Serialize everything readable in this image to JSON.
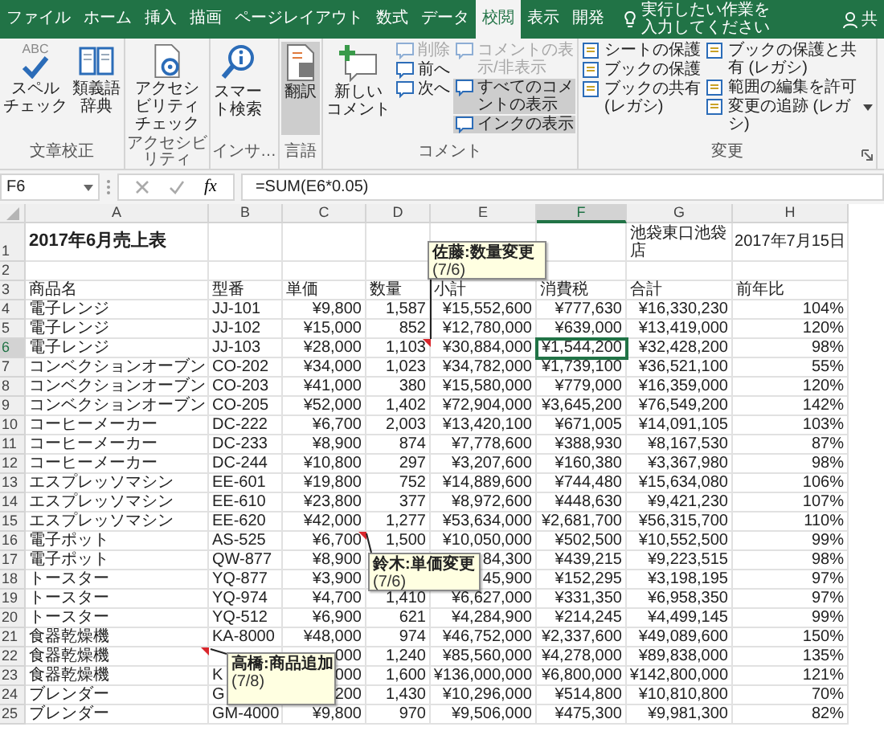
{
  "tabs": [
    {
      "label": "ファイル",
      "selected": false
    },
    {
      "label": "ホーム",
      "selected": false
    },
    {
      "label": "挿入",
      "selected": false
    },
    {
      "label": "描画",
      "selected": false
    },
    {
      "label": "ページレイアウト",
      "selected": false
    },
    {
      "label": "数式",
      "selected": false
    },
    {
      "label": "データ",
      "selected": false
    },
    {
      "label": "校閲",
      "selected": true
    },
    {
      "label": "表示",
      "selected": false
    },
    {
      "label": "開発",
      "selected": false
    }
  ],
  "tell_me": "実行したい作業を入力してください",
  "share": "共",
  "ribbon": [
    {
      "label": "文章校正",
      "items": [
        {
          "kind": "large",
          "icon_text": "ABC",
          "lines": [
            "スペル",
            "チェック"
          ],
          "on": false
        },
        {
          "kind": "large",
          "lines": [
            "類義語",
            "辞典"
          ],
          "on": false
        }
      ]
    },
    {
      "label": "アクセシビリティ",
      "items": [
        {
          "kind": "large",
          "lines": [
            "アクセシビリティ",
            "チェック"
          ],
          "on": false
        }
      ]
    },
    {
      "label": "インサ…",
      "items": [
        {
          "kind": "large",
          "lines": [
            "スマー",
            "ト検索"
          ],
          "on": false
        }
      ]
    },
    {
      "label": "言語",
      "items": [
        {
          "kind": "large",
          "lines": [
            "翻訳"
          ],
          "on": true
        }
      ]
    },
    {
      "label": "コメント",
      "items": [
        {
          "kind": "large",
          "lines": [
            "新しい",
            "コメント"
          ],
          "on": false
        },
        {
          "kind": "column",
          "buttons": [
            {
              "label": "削除",
              "disabled": true,
              "on": false
            },
            {
              "label": "前へ",
              "disabled": false,
              "on": false
            },
            {
              "label": "次へ",
              "disabled": false,
              "on": false
            }
          ]
        },
        {
          "kind": "column",
          "buttons": [
            {
              "label": "コメントの表示/非表示",
              "disabled": true,
              "on": false
            },
            {
              "label": "すべてのコメントの表示",
              "disabled": false,
              "on": true
            },
            {
              "label": "インクの表示",
              "disabled": false,
              "on": true
            }
          ]
        }
      ]
    },
    {
      "label": "変更",
      "launcher": true,
      "items": [
        {
          "kind": "column",
          "buttons": [
            {
              "label": "シートの保護",
              "disabled": false,
              "on": false
            },
            {
              "label": "ブックの保護",
              "disabled": false,
              "on": false
            },
            {
              "label": "ブックの共有 (レガシ)",
              "disabled": false,
              "on": false
            }
          ]
        },
        {
          "kind": "column",
          "buttons": [
            {
              "label": "ブックの保護と共有 (レガシ)",
              "disabled": false,
              "on": false
            },
            {
              "label": "範囲の編集を許可",
              "disabled": false,
              "on": false
            },
            {
              "label": "変更の追跡 (レガシ)",
              "disabled": false,
              "on": false,
              "dropdown": true
            }
          ]
        }
      ]
    }
  ],
  "name_box": "F6",
  "function_button": "fx",
  "formula": "=SUM(E6*0.05)",
  "columns": [
    {
      "label": "A",
      "selected": false
    },
    {
      "label": "B",
      "selected": false
    },
    {
      "label": "C",
      "selected": false
    },
    {
      "label": "D",
      "selected": false
    },
    {
      "label": "E",
      "selected": false
    },
    {
      "label": "F",
      "selected": true
    },
    {
      "label": "G",
      "selected": false
    },
    {
      "label": "H",
      "selected": false
    }
  ],
  "rows": [
    {
      "num": "1",
      "kind": "title",
      "selected": false,
      "cells": [
        "2017年6月売上表",
        null,
        null,
        null,
        null,
        null,
        "池袋東口池袋店",
        "2017年7月15日"
      ]
    },
    {
      "num": "2",
      "kind": "data",
      "selected": false
    },
    {
      "num": "3",
      "kind": "header",
      "selected": false,
      "cells": [
        "商品名",
        "型番",
        "単価",
        "数量",
        "小計",
        "消費税",
        "合計",
        "前年比"
      ]
    },
    {
      "num": "4",
      "kind": "data",
      "selected": false,
      "cells": [
        "電子レンジ",
        "JJ-101",
        "¥9,800",
        "1,587",
        "¥15,552,600",
        "¥777,630",
        "¥16,330,230",
        "104%"
      ]
    },
    {
      "num": "5",
      "kind": "data",
      "selected": false,
      "cells": [
        "電子レンジ",
        "JJ-102",
        "¥15,000",
        "852",
        "¥12,780,000",
        "¥639,000",
        "¥13,419,000",
        "120%"
      ]
    },
    {
      "num": "6",
      "kind": "data",
      "selected": true,
      "cells": [
        "電子レンジ",
        "JJ-103",
        "¥28,000",
        "1,103",
        "¥30,884,000",
        "¥1,544,200",
        "¥32,428,200",
        "98%"
      ]
    },
    {
      "num": "7",
      "kind": "data",
      "selected": false,
      "cells": [
        "コンベクションオーブン",
        "CO-202",
        "¥34,000",
        "1,023",
        "¥34,782,000",
        "¥1,739,100",
        "¥36,521,100",
        "55%"
      ]
    },
    {
      "num": "8",
      "kind": "data",
      "selected": false,
      "cells": [
        "コンベクションオーブン",
        "CO-203",
        "¥41,000",
        "380",
        "¥15,580,000",
        "¥779,000",
        "¥16,359,000",
        "120%"
      ]
    },
    {
      "num": "9",
      "kind": "data",
      "selected": false,
      "cells": [
        "コンベクションオーブン",
        "CO-205",
        "¥52,000",
        "1,402",
        "¥72,904,000",
        "¥3,645,200",
        "¥76,549,200",
        "142%"
      ]
    },
    {
      "num": "10",
      "kind": "data",
      "selected": false,
      "cells": [
        "コーヒーメーカー",
        "DC-222",
        "¥6,700",
        "2,003",
        "¥13,420,100",
        "¥671,005",
        "¥14,091,105",
        "103%"
      ]
    },
    {
      "num": "11",
      "kind": "data",
      "selected": false,
      "cells": [
        "コーヒーメーカー",
        "DC-233",
        "¥8,900",
        "874",
        "¥7,778,600",
        "¥388,930",
        "¥8,167,530",
        "87%"
      ]
    },
    {
      "num": "12",
      "kind": "data",
      "selected": false,
      "cells": [
        "コーヒーメーカー",
        "DC-244",
        "¥10,800",
        "297",
        "¥3,207,600",
        "¥160,380",
        "¥3,367,980",
        "98%"
      ]
    },
    {
      "num": "13",
      "kind": "data",
      "selected": false,
      "cells": [
        "エスプレッソマシン",
        "EE-601",
        "¥19,800",
        "752",
        "¥14,889,600",
        "¥744,480",
        "¥15,634,080",
        "106%"
      ]
    },
    {
      "num": "14",
      "kind": "data",
      "selected": false,
      "cells": [
        "エスプレッソマシン",
        "EE-610",
        "¥23,800",
        "377",
        "¥8,972,600",
        "¥448,630",
        "¥9,421,230",
        "107%"
      ]
    },
    {
      "num": "15",
      "kind": "data",
      "selected": false,
      "cells": [
        "エスプレッソマシン",
        "EE-620",
        "¥42,000",
        "1,277",
        "¥53,634,000",
        "¥2,681,700",
        "¥56,315,700",
        "110%"
      ]
    },
    {
      "num": "16",
      "kind": "data",
      "selected": false,
      "cells": [
        "電子ポット",
        "AS-525",
        "¥6,700",
        "1,500",
        "¥10,050,000",
        "¥502,500",
        "¥10,552,500",
        "99%"
      ]
    },
    {
      "num": "17",
      "kind": "data",
      "selected": false,
      "cells": [
        "電子ポット",
        "QW-877",
        "¥8,900",
        null,
        "84,300",
        "¥439,215",
        "¥9,223,515",
        "98%"
      ]
    },
    {
      "num": "18",
      "kind": "data",
      "selected": false,
      "cells": [
        "トースター",
        "YQ-877",
        "¥3,900",
        null,
        "45,900",
        "¥152,295",
        "¥3,198,195",
        "97%"
      ]
    },
    {
      "num": "19",
      "kind": "data",
      "selected": false,
      "cells": [
        "トースター",
        "YQ-974",
        "¥4,700",
        "1,410",
        "¥6,627,000",
        "¥331,350",
        "¥6,958,350",
        "97%"
      ]
    },
    {
      "num": "20",
      "kind": "data",
      "selected": false,
      "cells": [
        "トースター",
        "YQ-512",
        "¥6,900",
        "621",
        "¥4,284,900",
        "¥214,245",
        "¥4,499,145",
        "99%"
      ]
    },
    {
      "num": "21",
      "kind": "data",
      "selected": false,
      "cells": [
        "食器乾燥機",
        "KA-8000",
        "¥48,000",
        "974",
        "¥46,752,000",
        "¥2,337,600",
        "¥49,089,600",
        "150%"
      ]
    },
    {
      "num": "22",
      "kind": "data",
      "selected": false,
      "cells": [
        "食器乾燥機",
        null,
        "000",
        "1,240",
        "¥85,560,000",
        "¥4,278,000",
        "¥89,838,000",
        "135%"
      ]
    },
    {
      "num": "23",
      "kind": "data",
      "selected": false,
      "cells": [
        "食器乾燥機",
        "K",
        "000",
        "1,600",
        "¥136,000,000",
        "¥6,800,000",
        "¥142,800,000",
        "121%"
      ]
    },
    {
      "num": "24",
      "kind": "data",
      "selected": false,
      "cells": [
        "ブレンダー",
        "G",
        "200",
        "1,430",
        "¥10,296,000",
        "¥514,800",
        "¥10,810,800",
        "70%"
      ]
    },
    {
      "num": "25",
      "kind": "data",
      "selected": false,
      "cells": [
        "ブレンダー",
        "GM-4000",
        "¥9,800",
        "970",
        "¥9,506,000",
        "¥475,300",
        "¥9,981,300",
        "82%"
      ]
    }
  ],
  "comments": [
    {
      "author_line": "佐藤:数量変更",
      "date": "(7/6)"
    },
    {
      "author_line": "鈴木:単価変更",
      "date": "(7/6)"
    },
    {
      "author_line": "高橋:商品追加",
      "date": "(7/8)"
    }
  ]
}
